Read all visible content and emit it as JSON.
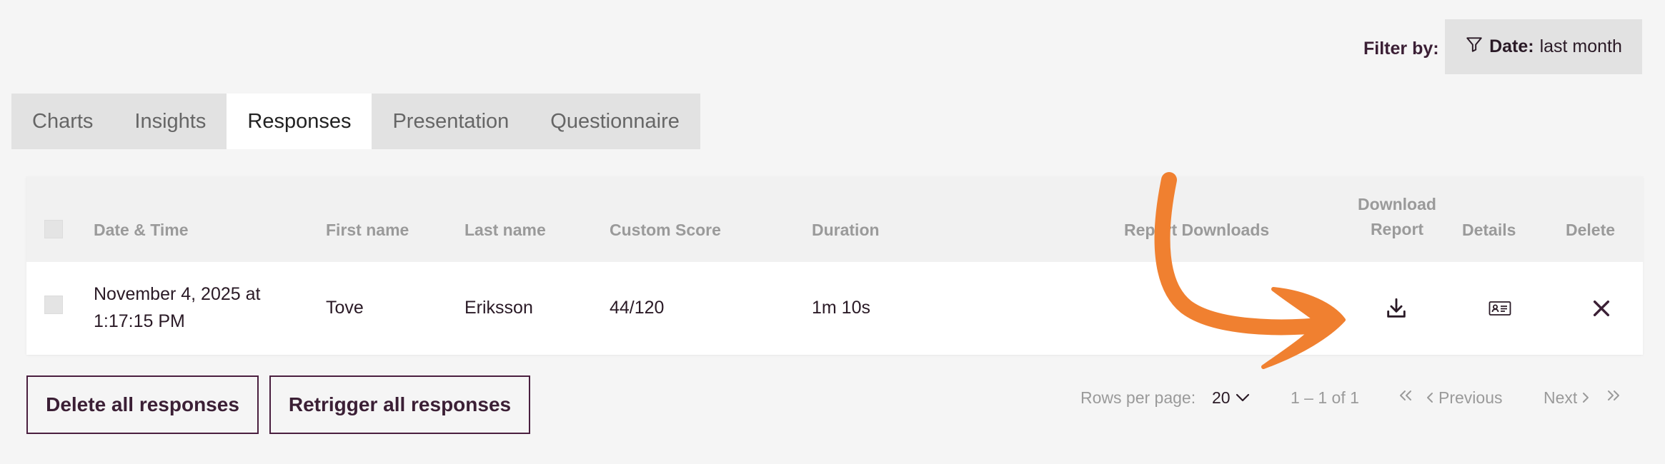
{
  "filter": {
    "label": "Filter by:",
    "key": "Date:",
    "value": "last month"
  },
  "tabs": [
    {
      "label": "Charts",
      "active": false
    },
    {
      "label": "Insights",
      "active": false
    },
    {
      "label": "Responses",
      "active": true
    },
    {
      "label": "Presentation",
      "active": false
    },
    {
      "label": "Questionnaire",
      "active": false
    }
  ],
  "table": {
    "headers": {
      "date_time": "Date & Time",
      "first_name": "First name",
      "last_name": "Last name",
      "custom_score": "Custom Score",
      "duration": "Duration",
      "report_downloads": "Report Downloads",
      "download_report_1": "Download",
      "download_report_2": "Report",
      "details": "Details",
      "delete": "Delete"
    },
    "rows": [
      {
        "date_line1": "November 4, 2025 at",
        "date_line2": "1:17:15 PM",
        "first_name": "Tove",
        "last_name": "Eriksson",
        "custom_score": "44/120",
        "duration": "1m 10s",
        "report_downloads": ""
      }
    ]
  },
  "actions": {
    "delete_all": "Delete all responses",
    "retrigger_all": "Retrigger all responses"
  },
  "pagination": {
    "rows_per_page_label": "Rows per page:",
    "rows_per_page_value": "20",
    "range": "1 – 1 of 1",
    "previous": "Previous",
    "next": "Next"
  },
  "colors": {
    "accent_arrow": "#f08030",
    "brand_text": "#3b1f35",
    "tab_bar": "#e2e2e2"
  }
}
